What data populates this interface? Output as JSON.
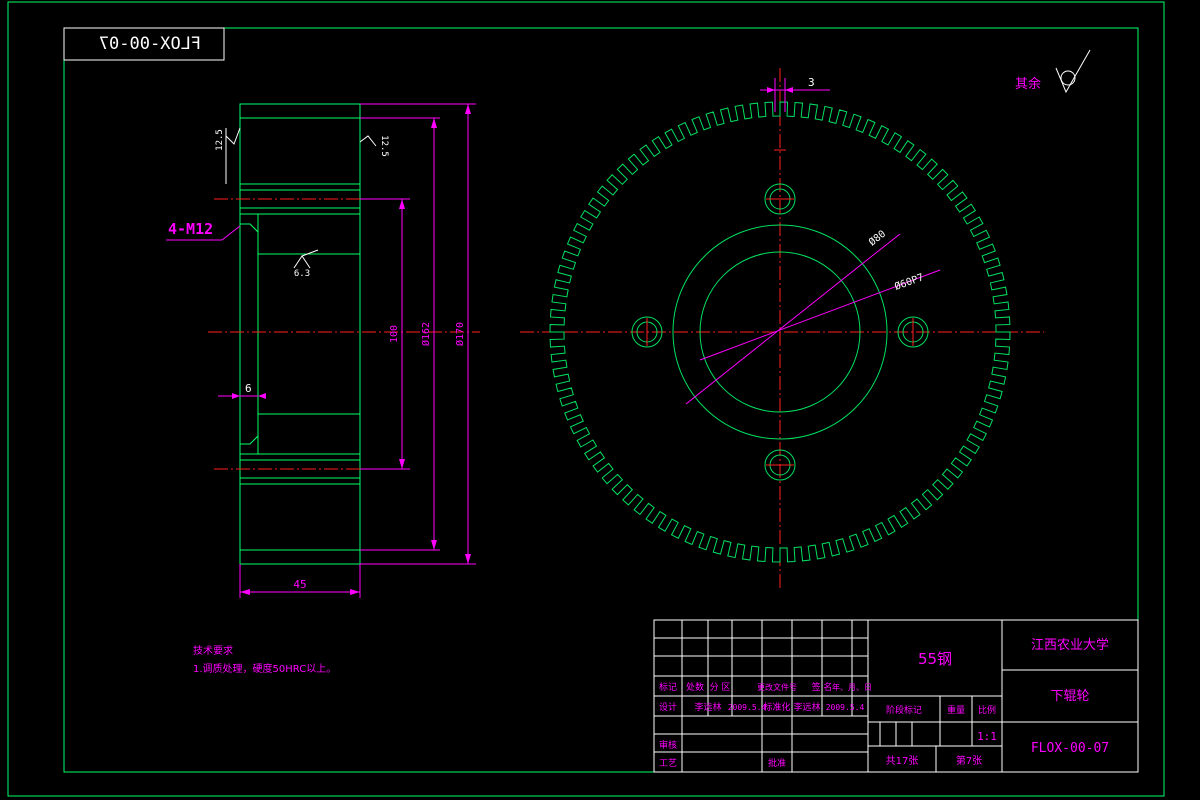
{
  "drawing_number": "FLOX-00-07",
  "drawing_number_mirrored": "FLOX-00-07",
  "surface_finish_note": "其余",
  "side_view": {
    "thread_callout": "4-M12",
    "roughness_top": "12.5",
    "roughness_top_right": "12.5",
    "roughness_bore": "6.3",
    "dims": {
      "d100": "100",
      "d162": "Ø162",
      "d170": "Ø170",
      "width": "45",
      "relief": "6"
    }
  },
  "front_view": {
    "dims": {
      "tooth_width": "3",
      "d80": "Ø80",
      "d60": "Ø60P7"
    }
  },
  "tech_requirements": {
    "title": "技术要求",
    "item1": "1.调质处理，硬度50HRC以上。"
  },
  "title_block": {
    "material": "55钢",
    "institution": "江西农业大学",
    "part_name": "下辊轮",
    "drawing_code": "FLOX-00-07",
    "row_labels": [
      "标记",
      "处数",
      "分 区",
      "更改文件号",
      "签 名",
      "年、月、日"
    ],
    "design_label": "设计",
    "designer": "李远林",
    "design_date": "2009.5.4",
    "standard_label": "标准化",
    "standardizer": "李远林",
    "standard_date": "2009.5.4",
    "review_label": "审核",
    "process_label": "工艺",
    "approve_label": "批准",
    "stage_label": "阶段标记",
    "weight_label": "重量",
    "scale_label": "比例",
    "scale_value": "1:1",
    "sheets_total": "共17张",
    "sheet_no": "第7张"
  }
}
